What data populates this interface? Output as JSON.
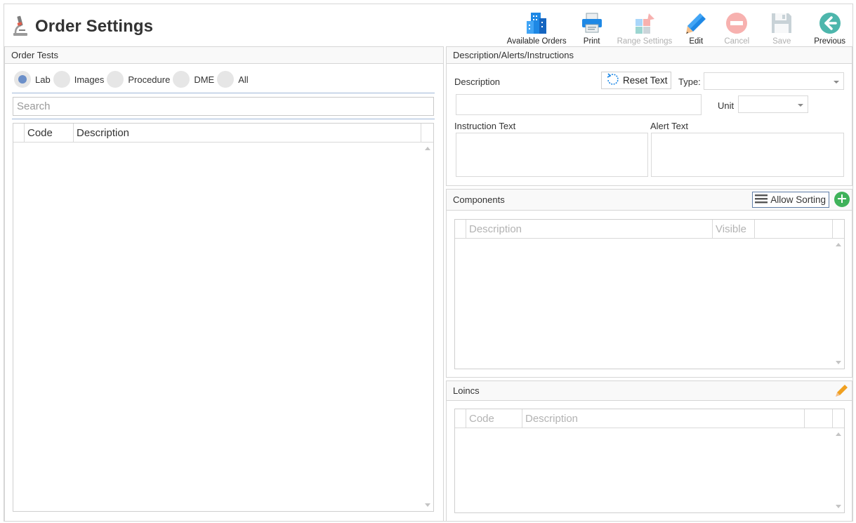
{
  "window": {
    "title": "Order Settings"
  },
  "toolbar": {
    "available_orders": "Available Orders",
    "print": "Print",
    "range_settings": "Range Settings",
    "edit": "Edit",
    "cancel": "Cancel",
    "save": "Save",
    "previous": "Previous"
  },
  "order_tests": {
    "title": "Order Tests",
    "radios": [
      "Lab",
      "Images",
      "Procedure",
      "DME",
      "All"
    ],
    "selected": "Lab",
    "search_placeholder": "Search",
    "columns": [
      "Code",
      "Description"
    ]
  },
  "description_panel": {
    "title": "Description/Alerts/Instructions",
    "description_label": "Description",
    "reset_text": "Reset Text",
    "type_label": "Type:",
    "type_value": "",
    "unit_label": "Unit",
    "unit_value": "",
    "instruction_label": "Instruction Text",
    "alert_label": "Alert Text"
  },
  "components": {
    "title": "Components",
    "allow_sorting": "Allow Sorting",
    "columns": [
      "Description",
      "Visible"
    ]
  },
  "loincs": {
    "title": "Loincs",
    "columns": [
      "Code",
      "Description"
    ]
  },
  "colors": {
    "accent_blue": "#1e88e5",
    "radio_selected": "#6b8fc9",
    "add_green": "#3fb25a",
    "edit_orange": "#f0a020"
  }
}
